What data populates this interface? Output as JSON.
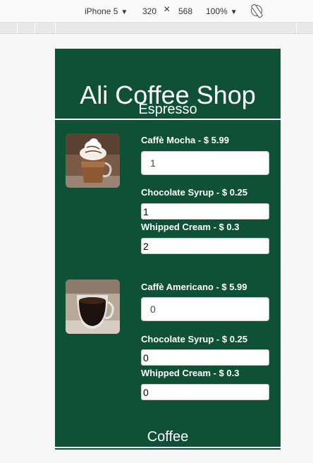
{
  "devtools": {
    "device": "iPhone 5",
    "width": "320",
    "times": "×",
    "height": "568",
    "zoom": "100%"
  },
  "shop": {
    "title": "Ali Coffee Shop"
  },
  "sections": {
    "espresso": "Espresso",
    "coffee": "Coffee"
  },
  "items": [
    {
      "label": "Caffè Mocha - $ 5.99",
      "quantity": "1",
      "addons": [
        {
          "label": "Chocolate Syrup - $ 0.25",
          "value": "1"
        },
        {
          "label": "Whipped Cream - $ 0.3",
          "value": "2"
        }
      ]
    },
    {
      "label": "Caffè Americano - $ 5.99",
      "quantity": "0",
      "addons": [
        {
          "label": "Chocolate Syrup - $ 0.25",
          "value": "0"
        },
        {
          "label": "Whipped Cream - $ 0.3",
          "value": "0"
        }
      ]
    }
  ],
  "colors": {
    "brand_green": "#0f5137"
  }
}
